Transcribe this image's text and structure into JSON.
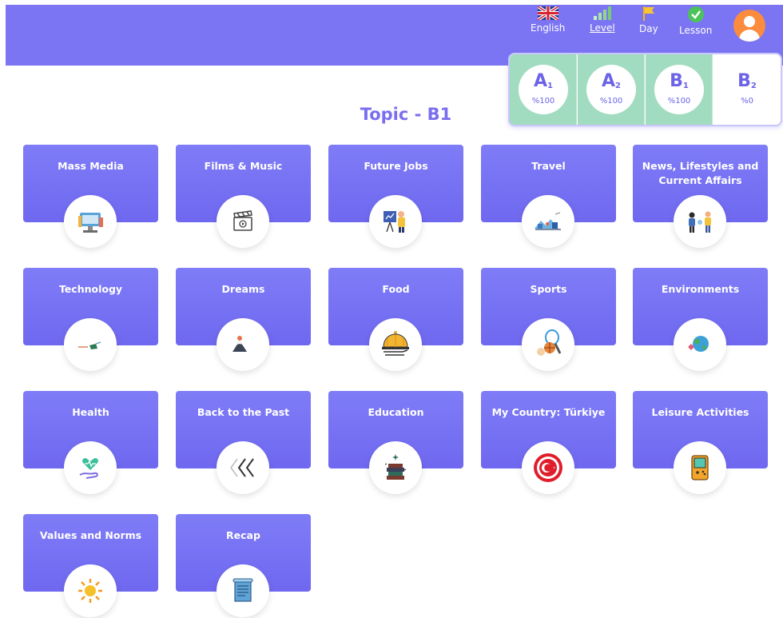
{
  "header": {
    "nav": [
      {
        "label": "English",
        "icon": "uk-flag-icon"
      },
      {
        "label": "Level",
        "icon": "signal-bars-icon",
        "active": true
      },
      {
        "label": "Day",
        "icon": "flag-icon"
      },
      {
        "label": "Lesson",
        "icon": "check-circle-icon"
      }
    ],
    "avatar_icon": "user-avatar-icon"
  },
  "levels": [
    {
      "base": "A",
      "sub": "1",
      "percent": "%100",
      "completed": true
    },
    {
      "base": "A",
      "sub": "2",
      "percent": "%100",
      "completed": true
    },
    {
      "base": "B",
      "sub": "1",
      "percent": "%100",
      "completed": true
    },
    {
      "base": "B",
      "sub": "2",
      "percent": "%0",
      "completed": false
    }
  ],
  "page_title": "Topic - B1",
  "topics": [
    {
      "title": "Mass Media",
      "icon": "computer-media-icon"
    },
    {
      "title": "Films & Music",
      "icon": "clapperboard-icon"
    },
    {
      "title": "Future Jobs",
      "icon": "presenter-icon"
    },
    {
      "title": "Travel",
      "icon": "travel-scene-icon"
    },
    {
      "title": "News, Lifestyles and Current Affairs",
      "icon": "people-talking-icon"
    },
    {
      "title": "Technology",
      "icon": "robot-hand-icon"
    },
    {
      "title": "Dreams",
      "icon": "moon-mountain-icon"
    },
    {
      "title": "Food",
      "icon": "food-cloche-icon"
    },
    {
      "title": "Sports",
      "icon": "sports-balls-icon"
    },
    {
      "title": "Environments",
      "icon": "earth-icon"
    },
    {
      "title": "Health",
      "icon": "heart-hand-icon"
    },
    {
      "title": "Back to the Past",
      "icon": "rewind-arrows-icon"
    },
    {
      "title": "Education",
      "icon": "books-stack-icon"
    },
    {
      "title": "My Country: Türkiye",
      "icon": "turkish-flag-icon"
    },
    {
      "title": "Leisure Activities",
      "icon": "game-console-icon"
    },
    {
      "title": "Values and Norms",
      "icon": "sun-icon"
    },
    {
      "title": "Recap",
      "icon": "scroll-document-icon"
    }
  ],
  "colors": {
    "primary": "#7b75f3",
    "completed": "#a2dcc0",
    "title": "#7a6ef0"
  }
}
